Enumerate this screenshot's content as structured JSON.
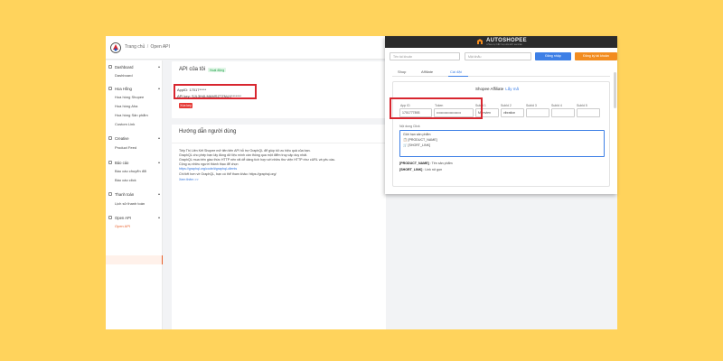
{
  "breadcrumb": {
    "home": "Trang chủ",
    "separator": "/",
    "current": "Open API"
  },
  "sidebar": {
    "groups": [
      {
        "label": "Dashboard",
        "items": [
          "Dashboard"
        ]
      },
      {
        "label": "Hoa Hồng",
        "items": [
          "Hoa hồng Shopee",
          "Hoa hồng Aha",
          "Hoa hồng Sản phẩm",
          "Custom Link"
        ]
      },
      {
        "label": "Creative",
        "items": [
          "Product Feed"
        ]
      },
      {
        "label": "Báo cáo",
        "items": [
          "Báo cáo chuyển đổi",
          "Báo cáo click"
        ]
      },
      {
        "label": "Thanh toán",
        "items": [
          "Lịch sử thanh toán"
        ]
      },
      {
        "label": "Open API",
        "items": [
          "Open API"
        ]
      }
    ],
    "active_item": "Open API"
  },
  "api_card": {
    "title": "API của tôi",
    "badge": "Hoạt động",
    "app_id": "AppID: 17017*****",
    "api_key": "API key: SJL3H4LMAMSZ7ZNUX*******",
    "delete_label": "Xóa key"
  },
  "guide_card": {
    "title": "Hướng dẫn người dùng",
    "lines": [
      "Tiếp Thị Liên Kết Shopee mở tiên tiến API hỗ trợ GraphQL để giúp tối ưu hiệu quả của bạn.",
      "GraphQL cho phép bạn lấy đúng dữ liệu mình cần thông qua một điểm truy cập duy nhất.",
      "GraphQL mua trên giao thức HTTP nên rất dễ dàng tích hợp với nhiều thư viện HTTP như cURL và yêu cầu.",
      "Cộng cụ nhiều người thành thạo để chọn",
      "https://graphql.org/code/#graphql-clients",
      "Chi tiết hơn về GraphQL, bạn có thể tham khảo: https://graphql.org/",
      "Xem thêm >>"
    ]
  },
  "popup": {
    "brand": "AUTOSHOPEE",
    "brand_sub": "CÔNG CỤ TIẾP THỊ LIÊN KẾT SHOPEE",
    "username_placeholder": "Tên tài khoản",
    "password_placeholder": "Mật khẩu",
    "login": "Đăng nhập",
    "register": "Đăng ký tài khoản",
    "tabs": [
      "Shop",
      "Affiliate",
      "Cài đặt"
    ],
    "active_tab": "Cài đặt",
    "affiliate_title": "Shopee Affiliate",
    "affiliate_link": "Lấy mã",
    "columns": [
      "App ID",
      "Token",
      "Subld 1",
      "Subld 2",
      "Subld 3",
      "Subld 4",
      "Subld 5"
    ],
    "values": [
      "1701777893",
      "••••••••••••••••••••••",
      "Mienvien",
      "vibration",
      "",
      "",
      ""
    ],
    "content_label": "Nội dung Click",
    "content_lines": [
      "Giới hạn sản phẩm",
      "📋 [PRODUCT_NAME]",
      "🛒 [SHORT_LINK]"
    ],
    "legend": [
      {
        "key": "[PRODUCT_NAME]",
        "desc": ": Tên sản phẩm"
      },
      {
        "key": "[SHORT_LINK]",
        "desc": ": Link rút gọn"
      }
    ]
  },
  "colors": {
    "background": "#ffd35c",
    "accent": "#e8612c",
    "highlight": "#d8262f",
    "primary": "#3d7fe6",
    "orange_button": "#f28c1f"
  }
}
